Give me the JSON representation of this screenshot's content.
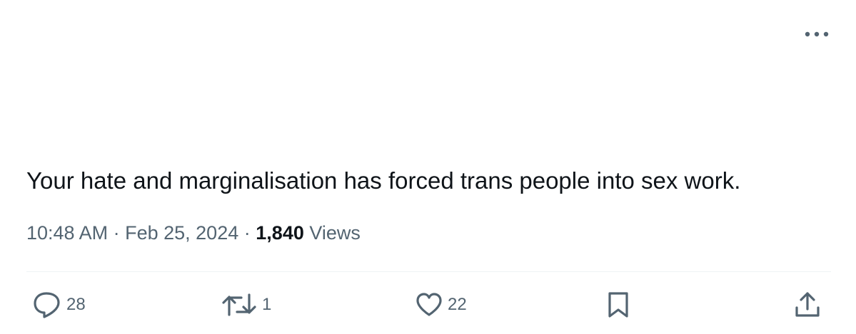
{
  "tweet": {
    "text": "Your hate and marginalisation has forced trans people into sex work.",
    "time": "10:48 AM",
    "separator": "·",
    "date": "Feb 25, 2024",
    "views_count": "1,840",
    "views_label": "Views"
  },
  "actions": {
    "reply_count": "28",
    "retweet_count": "1",
    "like_count": "22"
  },
  "colors": {
    "text": "#0f1419",
    "secondary": "#536471",
    "divider": "#eff3f4"
  },
  "icons": [
    "more-horizontal-icon",
    "reply-icon",
    "retweet-icon",
    "heart-icon",
    "bookmark-icon",
    "share-icon"
  ]
}
